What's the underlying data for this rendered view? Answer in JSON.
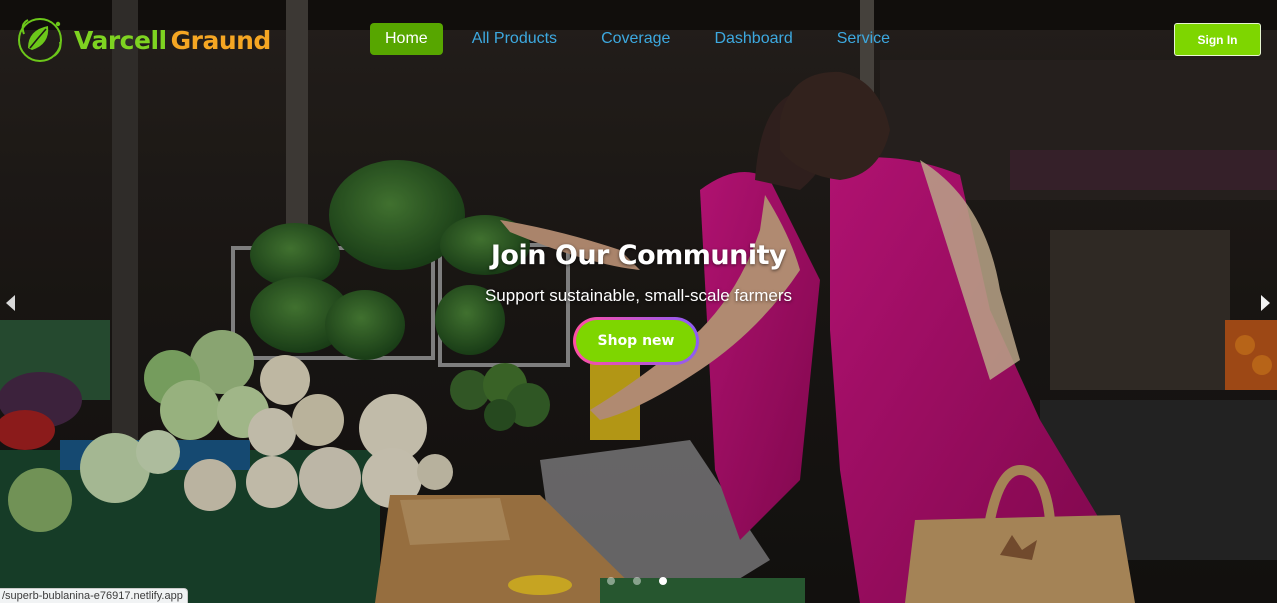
{
  "brand": {
    "name_part1": "Varcell",
    "name_part2": "Graund",
    "logo_icon": "leaf-globe-logo"
  },
  "nav": {
    "items": [
      {
        "label": "Home",
        "active": true
      },
      {
        "label": "All Products",
        "active": false
      },
      {
        "label": "Coverage",
        "active": false
      },
      {
        "label": "Dashboard",
        "active": false
      },
      {
        "label": "Service",
        "active": false
      }
    ]
  },
  "auth": {
    "signin_label": "Sign In"
  },
  "hero": {
    "title": "Join Our Community",
    "subtitle": "Support sustainable, small-scale farmers",
    "cta_label": "Shop new",
    "prev_icon": "chevron-left-icon",
    "next_icon": "chevron-right-icon",
    "slide_count": 3,
    "active_slide": 3
  },
  "status_bar": {
    "url": "/superb-bublanina-e76917.netlify.app"
  },
  "colors": {
    "brand_green": "#7ed321",
    "brand_orange": "#f5a623",
    "nav_link": "#3da9e0",
    "nav_active_bg": "#57a600",
    "cta_green": "#7ed600",
    "cta_border_from": "#ff4fa3",
    "cta_border_to": "#8b5cf6"
  }
}
